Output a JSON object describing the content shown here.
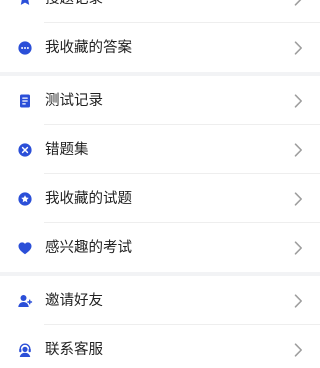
{
  "colors": {
    "accent": "#2b4fd8",
    "chevron": "#9e9e9e",
    "separator": "#f2f3f5",
    "divider": "#eeeeee"
  },
  "menu": {
    "group1": [
      {
        "label": "搜题记录",
        "icon": "star-icon"
      },
      {
        "label": "我收藏的答案",
        "icon": "chat-bubble-icon"
      }
    ],
    "group2": [
      {
        "label": "测试记录",
        "icon": "document-icon"
      },
      {
        "label": "错题集",
        "icon": "close-circle-icon"
      },
      {
        "label": "我收藏的试题",
        "icon": "star-circle-icon"
      },
      {
        "label": "感兴趣的考试",
        "icon": "heart-icon"
      }
    ],
    "group3": [
      {
        "label": "邀请好友",
        "icon": "add-user-icon"
      },
      {
        "label": "联系客服",
        "icon": "customer-service-icon"
      }
    ]
  }
}
